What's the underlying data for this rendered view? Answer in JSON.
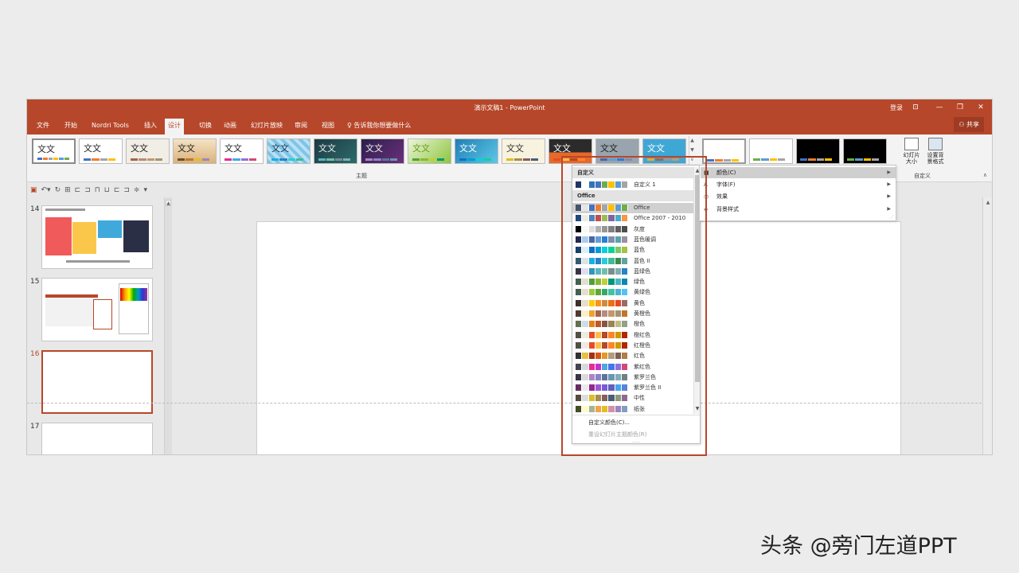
{
  "window": {
    "title": "演示文稿1 - PowerPoint",
    "login": "登录",
    "controls": [
      "⊡",
      "—",
      "❐",
      "✕"
    ]
  },
  "tabs": [
    "文件",
    "开始",
    "Nordri Tools",
    "插入",
    "设计",
    "切换",
    "动画",
    "幻灯片放映",
    "审阅",
    "视图"
  ],
  "active_tab": "设计",
  "tell_me": "告诉我你想要做什么",
  "share": "共享",
  "ribbon": {
    "themes_label": "主题",
    "theme_thumb_text": "文文",
    "theme_thumb_text_alt": "文文",
    "custom_label": "自定义",
    "slide_size": "幻灯片\n大小",
    "format_bg": "设置背\n景格式"
  },
  "slides": {
    "numbers": [
      "14",
      "15",
      "16",
      "17"
    ],
    "active": "16"
  },
  "dropdown": {
    "custom_header": "自定义",
    "custom_items": [
      {
        "name": "自定义 1",
        "colors": [
          "#1f3864",
          "#ffffff",
          "#2e75b6",
          "#4472c4",
          "#70ad47",
          "#ffc000",
          "#5b9bd5",
          "#a5a5a5"
        ]
      }
    ],
    "office_header": "Office",
    "office_items": [
      {
        "name": "Office",
        "colors": [
          "#44546a",
          "#e7e6e6",
          "#4472c4",
          "#ed7d31",
          "#a5a5a5",
          "#ffc000",
          "#5b9bd5",
          "#70ad47"
        ],
        "selected": true
      },
      {
        "name": "Office 2007 - 2010",
        "colors": [
          "#1f497d",
          "#eeece1",
          "#4f81bd",
          "#c0504d",
          "#9bbb59",
          "#8064a2",
          "#4bacc6",
          "#f79646"
        ]
      },
      {
        "name": "灰度",
        "colors": [
          "#000000",
          "#f8f8f8",
          "#dddddd",
          "#b2b2b2",
          "#969696",
          "#808080",
          "#5f5f5f",
          "#4d4d4d"
        ]
      },
      {
        "name": "蓝色暖调",
        "colors": [
          "#242852",
          "#acccea",
          "#4a66ac",
          "#629dd1",
          "#297fd5",
          "#7f8fa9",
          "#5aa2ae",
          "#9d90a0"
        ]
      },
      {
        "name": "蓝色",
        "colors": [
          "#17406d",
          "#dbeff9",
          "#0f6fc6",
          "#009dd9",
          "#0bd0d9",
          "#10cf9b",
          "#7cca62",
          "#a5c249"
        ]
      },
      {
        "name": "蓝色 II",
        "colors": [
          "#335b74",
          "#dfe3e5",
          "#1cade4",
          "#2683c6",
          "#27ced7",
          "#42ba97",
          "#3e8853",
          "#62a39f"
        ]
      },
      {
        "name": "蓝绿色",
        "colors": [
          "#373545",
          "#dedef0",
          "#3494ba",
          "#58b6c0",
          "#75bda7",
          "#7a8c8e",
          "#84acb6",
          "#2683c6"
        ]
      },
      {
        "name": "绿色",
        "colors": [
          "#455f51",
          "#e3ded1",
          "#549e39",
          "#8ab833",
          "#c0cf3a",
          "#029676",
          "#4ab5c4",
          "#0989b1"
        ]
      },
      {
        "name": "黄绿色",
        "colors": [
          "#455f51",
          "#e3ded1",
          "#99cb38",
          "#63a537",
          "#37a76f",
          "#44c1a3",
          "#4eb3cf",
          "#51c3f9"
        ]
      },
      {
        "name": "黄色",
        "colors": [
          "#39302a",
          "#e5dec9",
          "#ffca08",
          "#f8931d",
          "#ce8d3e",
          "#ec7016",
          "#e64823",
          "#9c6a6a"
        ]
      },
      {
        "name": "黄橙色",
        "colors": [
          "#4e3b30",
          "#fbeec9",
          "#f0a22e",
          "#a5644e",
          "#b58b80",
          "#c3986d",
          "#a19574",
          "#c17529"
        ]
      },
      {
        "name": "橙色",
        "colors": [
          "#637052",
          "#ccddea",
          "#e48312",
          "#bd582c",
          "#865640",
          "#9b8357",
          "#c2bc80",
          "#94a088"
        ]
      },
      {
        "name": "橙红色",
        "colors": [
          "#505046",
          "#eeece1",
          "#e84c22",
          "#ffbd47",
          "#b64926",
          "#ff8427",
          "#cc9900",
          "#b22600"
        ]
      },
      {
        "name": "红橙色",
        "colors": [
          "#505046",
          "#eeece1",
          "#e84c22",
          "#ffbd47",
          "#b64926",
          "#ff8427",
          "#cc9900",
          "#b22600"
        ]
      },
      {
        "name": "红色",
        "colors": [
          "#323232",
          "#e5c243",
          "#a5300f",
          "#d55816",
          "#e19825",
          "#b19c7d",
          "#7f5f52",
          "#b27d49"
        ]
      },
      {
        "name": "紫红色",
        "colors": [
          "#454551",
          "#d8d9dc",
          "#e32d91",
          "#c830cc",
          "#4ea6dc",
          "#4775e7",
          "#8971e1",
          "#d54773"
        ]
      },
      {
        "name": "紫罗兰色",
        "colors": [
          "#373545",
          "#dcd8dc",
          "#ad84c6",
          "#8784c7",
          "#5d739a",
          "#6997af",
          "#84acb6",
          "#6f8183"
        ]
      },
      {
        "name": "紫罗兰色 II",
        "colors": [
          "#632e62",
          "#eaeaea",
          "#92278f",
          "#9b57d3",
          "#755dd9",
          "#665eb8",
          "#45a5ed",
          "#5982db"
        ]
      },
      {
        "name": "中性",
        "colors": [
          "#564b3c",
          "#ddddde",
          "#dcbd23",
          "#a68d4f",
          "#855e5e",
          "#4b5b7a",
          "#8b9a79",
          "#8e6a8e"
        ]
      },
      {
        "name": "纸张",
        "colors": [
          "#444d26",
          "#fefac9",
          "#a5b592",
          "#f3a447",
          "#e7bc29",
          "#d092a7",
          "#9c85c0",
          "#809ec2"
        ]
      }
    ],
    "customize": "自定义颜色(C)...",
    "reset": "重设幻灯片主题颜色(R)",
    "grip": "....."
  },
  "submenu": {
    "items": [
      {
        "label": "颜色(C)",
        "icon": "■"
      },
      {
        "label": "字体(F)",
        "icon": "A"
      },
      {
        "label": "效果",
        "icon": "◎"
      },
      {
        "label": "背景样式",
        "icon": "◈"
      }
    ]
  },
  "watermark": "头条 @旁门左道PPT"
}
